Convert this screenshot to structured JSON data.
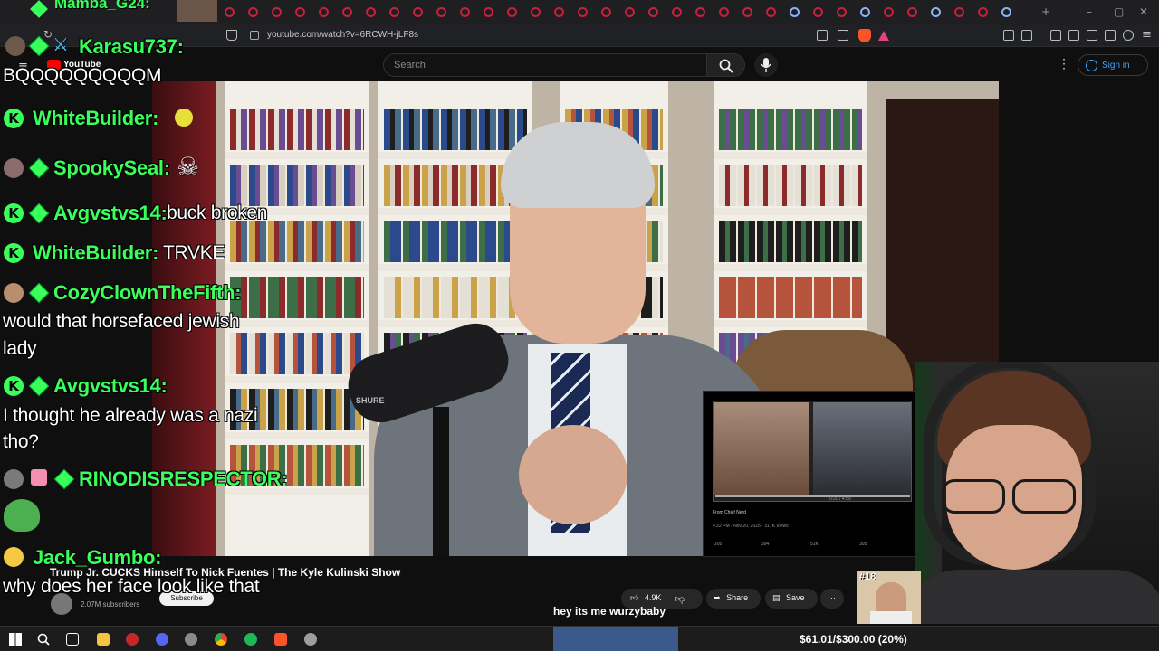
{
  "browser": {
    "top_tab_label": "Mamba_G24:",
    "url": "youtube.com/watch?v=6RCWH-jLF8s"
  },
  "youtube": {
    "logo_text": "YouTube",
    "search_placeholder": "Search",
    "signin_label": "Sign in",
    "video_title": "Trump Jr. CUCKS Himself To Nick Fuentes | The Kyle Kulinski Show",
    "subscribers": "2.07M subscribers",
    "subscribe_label": "Subscribe",
    "like_count": "4.9K",
    "share_label": "Share",
    "save_label": "Save"
  },
  "tweet_card": {
    "from_label": "From Chief Nerd",
    "timestamp": "4:22 PM · Nov 20, 2025 · 317K Views",
    "time": "0:20 / 4:59",
    "stats": [
      "205",
      "394",
      "51K",
      "305"
    ]
  },
  "chat": [
    {
      "name": "Karasu737:",
      "text": "BQQQQQQQQQM",
      "badge": "avatar"
    },
    {
      "name": "WhiteBuilder:",
      "text": "",
      "badge": "k"
    },
    {
      "name": "SpookySeal:",
      "text": "",
      "badge": "avatar"
    },
    {
      "name": "Avgvstvs14:",
      "text": "buck broken",
      "badge": "k"
    },
    {
      "name": "WhiteBuilder:",
      "text": "TRVKE",
      "badge": "k"
    },
    {
      "name": "CozyClownTheFifth:",
      "text": "would that horsefaced jewish",
      "text2": "lady",
      "badge": "avatar"
    },
    {
      "name": "Avgvstvs14:",
      "text": "I thought he already was a nazi",
      "text2": "tho?",
      "badge": "k"
    },
    {
      "name": "RINODISRESPECTOR:",
      "text": "",
      "badge": "avatar"
    },
    {
      "name": "Jack_Gumbo:",
      "text": "why does her face look like that",
      "badge": "emoji"
    }
  ],
  "caption": "hey its me wurzybaby",
  "rank_badge": "#18",
  "taskbar": {
    "goal_text": "$61.01/$300.00 (20%)"
  },
  "colors": {
    "chat_name": "#39ff5a",
    "youtube_bg": "#0f0f0f",
    "link_blue": "#3ea6ff"
  }
}
